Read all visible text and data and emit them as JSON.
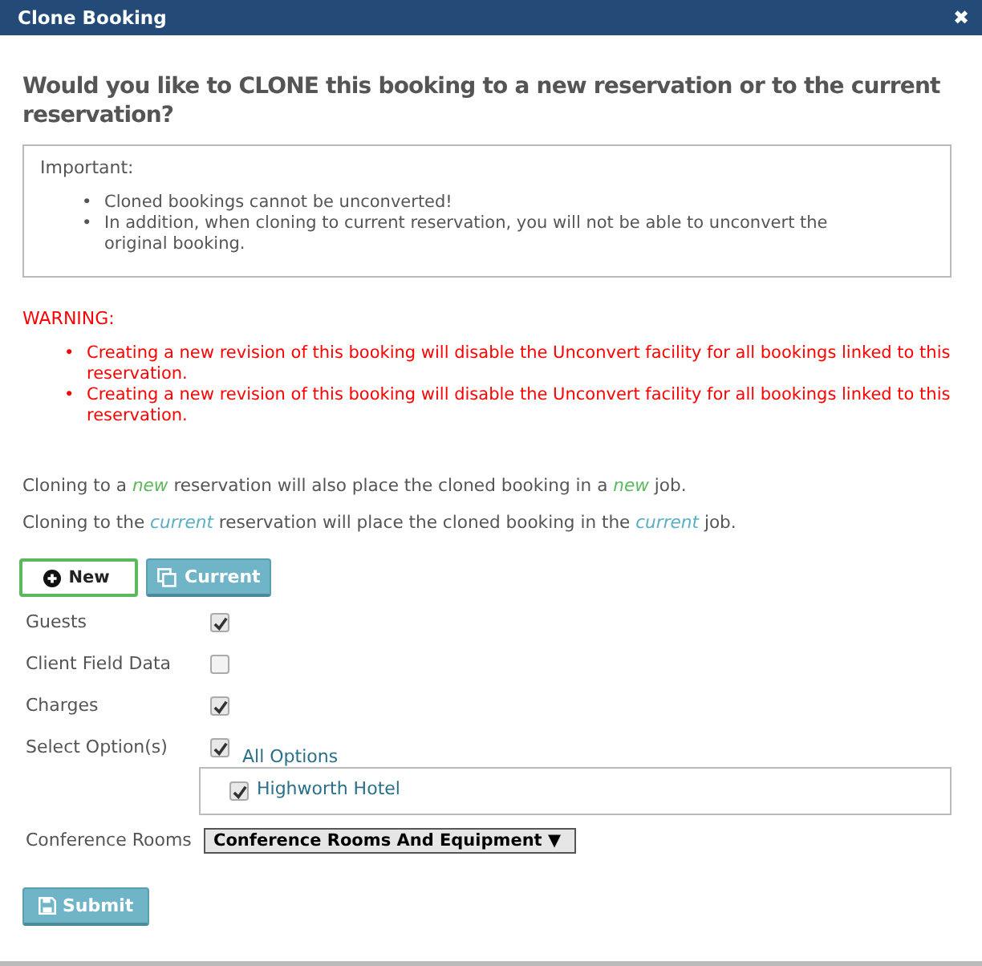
{
  "window": {
    "title": "Clone Booking",
    "close": "✖"
  },
  "heading": "Would you like to CLONE this booking to a new reservation or to the current reservation?",
  "important": {
    "title": "Important:",
    "bullet": "•",
    "items": [
      "Cloned bookings cannot be unconverted!",
      "In addition, when cloning to current reservation, you will not be able to unconvert the original booking."
    ]
  },
  "warning": {
    "title": "WARNING:",
    "bullet": "•",
    "items": [
      "Creating a new revision of this booking will disable the Unconvert facility for all bookings linked to this reservation.",
      "Creating a new revision of this booking will disable the Unconvert facility for all bookings linked to this reservation."
    ]
  },
  "notes": [
    [
      {
        "text": "Cloning to a "
      },
      {
        "text": "new",
        "color": "#5cb85c"
      },
      {
        "text": " reservation will also place the cloned booking in a "
      },
      {
        "text": "new",
        "color": "#5cb85c"
      },
      {
        "text": " job."
      }
    ],
    [
      {
        "text": "Cloning to the "
      },
      {
        "text": "current",
        "color": "#5bafc4"
      },
      {
        "text": " reservation will place the cloned booking in the "
      },
      {
        "text": "current",
        "color": "#5bafc4"
      },
      {
        "text": " job."
      }
    ]
  ],
  "modes": [
    {
      "label": "New",
      "kind": "new",
      "selected": true
    },
    {
      "label": "Current",
      "kind": "current",
      "selected": false
    }
  ],
  "fields": [
    {
      "label": "Guests",
      "kind": "checkbox",
      "checked": true
    },
    {
      "label": "Client Field Data",
      "kind": "checkbox",
      "checked": false
    },
    {
      "label": "Charges",
      "kind": "checkbox",
      "checked": true
    },
    {
      "label": "Select Option(s)",
      "kind": "options",
      "checked": true,
      "option_label": "All Options",
      "options": [
        {
          "label": "Highworth Hotel",
          "checked": true
        }
      ]
    },
    {
      "label": "Conference Rooms",
      "kind": "select",
      "value": "Conference Rooms And Equipment",
      "arrow": "▼"
    }
  ],
  "submit": "Submit"
}
